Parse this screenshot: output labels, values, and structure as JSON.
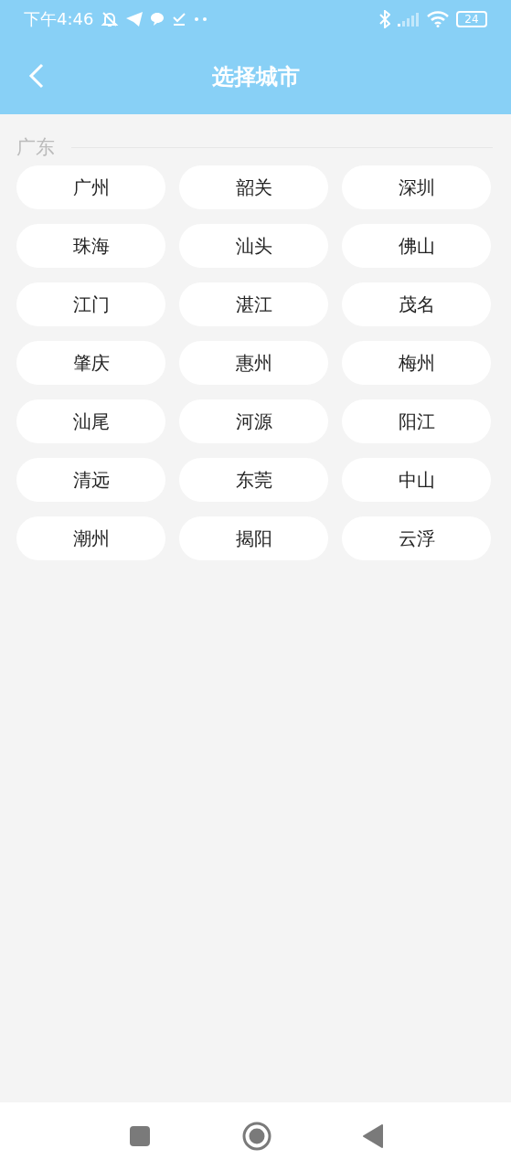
{
  "status_bar": {
    "time": "下午4:46",
    "battery": "24"
  },
  "header": {
    "title": "选择城市"
  },
  "section": {
    "title": "广东",
    "cities": [
      "广州",
      "韶关",
      "深圳",
      "珠海",
      "汕头",
      "佛山",
      "江门",
      "湛江",
      "茂名",
      "肇庆",
      "惠州",
      "梅州",
      "汕尾",
      "河源",
      "阳江",
      "清远",
      "东莞",
      "中山",
      "潮州",
      "揭阳",
      "云浮"
    ]
  }
}
